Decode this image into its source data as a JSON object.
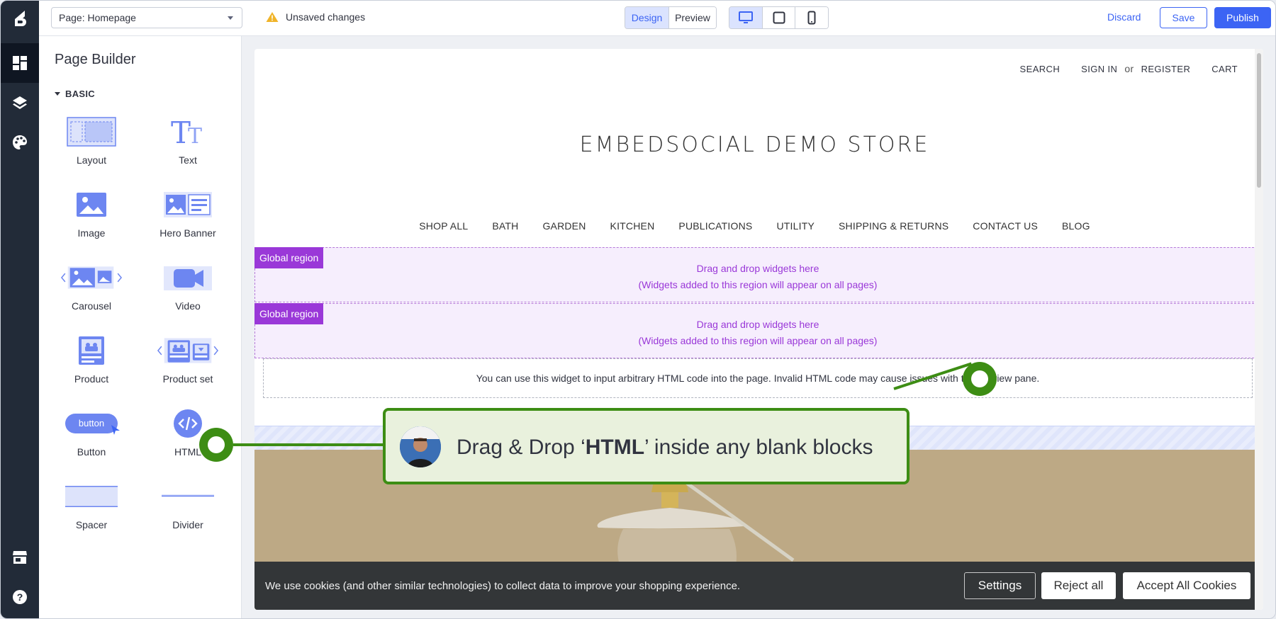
{
  "topbar": {
    "page_select": "Page: Homepage",
    "unsaved": "Unsaved changes",
    "view_tabs": [
      "Design",
      "Preview"
    ],
    "devices": [
      "desktop-icon",
      "tablet-icon",
      "mobile-icon"
    ],
    "discard": "Discard",
    "save": "Save",
    "publish": "Publish"
  },
  "rail": {
    "items": [
      "dashboard-icon",
      "layers-icon",
      "palette-icon",
      "storefront-icon",
      "help-icon"
    ]
  },
  "panel": {
    "title": "Page Builder",
    "section": "BASIC",
    "widgets": [
      {
        "label": "Layout",
        "icon": "layout-icon"
      },
      {
        "label": "Text",
        "icon": "text-icon"
      },
      {
        "label": "Image",
        "icon": "image-icon"
      },
      {
        "label": "Hero Banner",
        "icon": "hero-banner-icon"
      },
      {
        "label": "Carousel",
        "icon": "carousel-icon"
      },
      {
        "label": "Video",
        "icon": "video-icon"
      },
      {
        "label": "Product",
        "icon": "product-icon"
      },
      {
        "label": "Product set",
        "icon": "product-set-icon"
      },
      {
        "label": "Button",
        "icon": "button-icon",
        "icon_text": "button"
      },
      {
        "label": "HTML",
        "icon": "html-code-icon"
      },
      {
        "label": "Spacer",
        "icon": "spacer-icon"
      },
      {
        "label": "Divider",
        "icon": "divider-icon"
      }
    ]
  },
  "store": {
    "top_links": {
      "search": "SEARCH",
      "sign_in": "SIGN IN",
      "or": "or",
      "register": "REGISTER",
      "cart": "CART"
    },
    "title": "EMBEDSOCIAL DEMO STORE",
    "nav": [
      "SHOP ALL",
      "BATH",
      "GARDEN",
      "KITCHEN",
      "PUBLICATIONS",
      "UTILITY",
      "SHIPPING & RETURNS",
      "CONTACT US",
      "BLOG"
    ],
    "regions": [
      {
        "tag": "Global region",
        "line1": "Drag and drop widgets here",
        "line2": "(Widgets added to this region will appear on all pages)"
      },
      {
        "tag": "Global region",
        "line1": "Drag and drop widgets here",
        "line2": "(Widgets added to this region will appear on all pages)"
      }
    ],
    "html_widget_text": "You can use this widget to input arbitrary HTML code into the page. Invalid HTML code may cause issues with the preview pane.",
    "cookies": {
      "text": "We use cookies (and other similar technologies) to collect data to improve your shopping experience.",
      "settings": "Settings",
      "reject": "Reject all",
      "accept": "Accept All Cookies"
    }
  },
  "callout": {
    "prefix": "Drag & Drop ‘",
    "bold": "HTML",
    "suffix": "’ inside any blank blocks"
  },
  "colors": {
    "accent": "#3c64f4",
    "callout_green": "#3d8d14",
    "region_purple": "#9a38d8",
    "rail_dark": "#222b38"
  }
}
